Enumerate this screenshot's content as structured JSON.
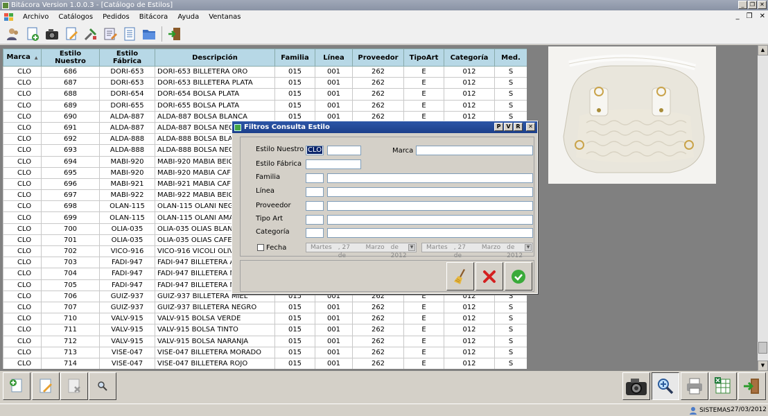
{
  "window": {
    "title": "Bitácora Version 1.0.0.3 - [Catálogo de Estilos]"
  },
  "menu": [
    "Archivo",
    "Catálogos",
    "Pedidos",
    "Bitácora",
    "Ayuda",
    "Ventanas"
  ],
  "toolbar_icons": [
    "users-icon",
    "add-document-icon",
    "camera-icon",
    "edit-document-icon",
    "tools-icon",
    "report-icon",
    "list-document-icon",
    "folder-icon",
    "exit-icon"
  ],
  "grid": {
    "columns": [
      {
        "label": "Marca",
        "sort": "▲"
      },
      {
        "label": "Estilo\nNuestro"
      },
      {
        "label": "Estilo\nFábrica"
      },
      {
        "label": "Descripción"
      },
      {
        "label": "Familia"
      },
      {
        "label": "Línea"
      },
      {
        "label": "Proveedor"
      },
      {
        "label": "TipoArt"
      },
      {
        "label": "Categoría"
      },
      {
        "label": "Med."
      }
    ],
    "rows": [
      [
        "CLO",
        "686",
        "DORI-653",
        "DORI-653 BILLETERA ORO",
        "015",
        "001",
        "262",
        "E",
        "012",
        "S"
      ],
      [
        "CLO",
        "687",
        "DORI-653",
        "DORI-653 BILLETERA PLATA",
        "015",
        "001",
        "262",
        "E",
        "012",
        "S"
      ],
      [
        "CLO",
        "688",
        "DORI-654",
        "DORI-654 BOLSA PLATA",
        "015",
        "001",
        "262",
        "E",
        "012",
        "S"
      ],
      [
        "CLO",
        "689",
        "DORI-655",
        "DORI-655 BOLSA PLATA",
        "015",
        "001",
        "262",
        "E",
        "012",
        "S"
      ],
      [
        "CLO",
        "690",
        "ALDA-887",
        "ALDA-887 BOLSA BLANCA",
        "015",
        "001",
        "262",
        "E",
        "012",
        "S"
      ],
      [
        "CLO",
        "691",
        "ALDA-887",
        "ALDA-887 BOLSA NEGRA",
        "",
        "",
        "",
        "",
        "",
        ""
      ],
      [
        "CLO",
        "692",
        "ALDA-888",
        "ALDA-888 BOLSA BLANCA",
        "",
        "",
        "",
        "",
        "",
        ""
      ],
      [
        "CLO",
        "693",
        "ALDA-888",
        "ALDA-888 BOLSA NEGRA",
        "",
        "",
        "",
        "",
        "",
        ""
      ],
      [
        "CLO",
        "694",
        "MABI-920",
        "MABI-920 MABIA BEIGE BO",
        "",
        "",
        "",
        "",
        "",
        ""
      ],
      [
        "CLO",
        "695",
        "MABI-920",
        "MABI-920 MABIA CAFE BO",
        "",
        "",
        "",
        "",
        "",
        ""
      ],
      [
        "CLO",
        "696",
        "MABI-921",
        "MABI-921 MABIA CAFE BO",
        "",
        "",
        "",
        "",
        "",
        ""
      ],
      [
        "CLO",
        "697",
        "MABI-922",
        "MABI-922 MABIA BEIGE BO",
        "",
        "",
        "",
        "",
        "",
        ""
      ],
      [
        "CLO",
        "698",
        "OLAN-115",
        "OLAN-115 OLANI NEGRO I",
        "",
        "",
        "",
        "",
        "",
        ""
      ],
      [
        "CLO",
        "699",
        "OLAN-115",
        "OLAN-115 OLANI AMARILL",
        "",
        "",
        "",
        "",
        "",
        ""
      ],
      [
        "CLO",
        "700",
        "OLIA-035",
        "OLIA-035 OLIAS BLANCO E",
        "",
        "",
        "",
        "",
        "",
        ""
      ],
      [
        "CLO",
        "701",
        "OLIA-035",
        "OLIA-035 OLIAS CAFE BOL",
        "",
        "",
        "",
        "",
        "",
        ""
      ],
      [
        "CLO",
        "702",
        "VICO-916",
        "VICO-916 VICOLI OLIVO BO",
        "",
        "",
        "",
        "",
        "",
        ""
      ],
      [
        "CLO",
        "703",
        "FADI-947",
        "FADI-947 BILLETERA AMA",
        "",
        "",
        "",
        "",
        "",
        ""
      ],
      [
        "CLO",
        "704",
        "FADI-947",
        "FADI-947 BILLETERA MOF",
        "",
        "",
        "",
        "",
        "",
        ""
      ],
      [
        "CLO",
        "705",
        "FADI-947",
        "FADI-947 BILLETERA NEG",
        "",
        "",
        "",
        "",
        "",
        ""
      ],
      [
        "CLO",
        "706",
        "GUIZ-937",
        "GUIZ-937 BILLETERA MIEL",
        "015",
        "001",
        "262",
        "E",
        "012",
        "S"
      ],
      [
        "CLO",
        "707",
        "GUIZ-937",
        "GUIZ-937 BILLETERA NEGRO",
        "015",
        "001",
        "262",
        "E",
        "012",
        "S"
      ],
      [
        "CLO",
        "710",
        "VALV-915",
        "VALV-915 BOLSA VERDE",
        "015",
        "001",
        "262",
        "E",
        "012",
        "S"
      ],
      [
        "CLO",
        "711",
        "VALV-915",
        "VALV-915 BOLSA TINTO",
        "015",
        "001",
        "262",
        "E",
        "012",
        "S"
      ],
      [
        "CLO",
        "712",
        "VALV-915",
        "VALV-915 BOLSA NARANJA",
        "015",
        "001",
        "262",
        "E",
        "012",
        "S"
      ],
      [
        "CLO",
        "713",
        "VISE-047",
        "VISE-047 BILLETERA MORADO",
        "015",
        "001",
        "262",
        "E",
        "012",
        "S"
      ],
      [
        "CLO",
        "714",
        "VISE-047",
        "VISE-047 BILLETERA ROJO",
        "015",
        "001",
        "262",
        "E",
        "012",
        "S"
      ]
    ]
  },
  "dialog": {
    "title": "Filtros Consulta Estilo",
    "ctrls": [
      "P",
      "V",
      "R",
      "✕"
    ],
    "labels": {
      "estilo_nuestro": "Estilo Nuestro",
      "marca": "Marca",
      "estilo_fabrica": "Estilo Fábrica",
      "familia": "Familia",
      "linea": "Línea",
      "proveedor": "Proveedor",
      "tipo_art": "Tipo Art",
      "categoria": "Categoría",
      "fecha": "Fecha"
    },
    "estilo_prefix_value": "CLO",
    "date_from": {
      "day": "Martes",
      "num": ", 27 de",
      "month": "Marzo",
      "year": "de 2012"
    },
    "date_to": {
      "day": "Martes",
      "num": ", 27 de",
      "month": "Marzo",
      "year": "de 2012"
    },
    "actions": [
      "broom-icon",
      "cancel-x-icon",
      "accept-check-icon"
    ]
  },
  "bottom_toolbar": {
    "left": [
      "add-record-icon",
      "edit-record-icon",
      "delete-record-icon",
      "search-icon"
    ],
    "right": [
      "camera-icon",
      "zoom-icon",
      "print-icon",
      "excel-icon",
      "exit-icon"
    ]
  },
  "status": {
    "user": "SISTEMAS",
    "date": "27/03/2012"
  },
  "colors": {
    "grid_header": "#b7d8e6",
    "dialog_title": "#1c3f8a",
    "workspace": "#808080"
  }
}
